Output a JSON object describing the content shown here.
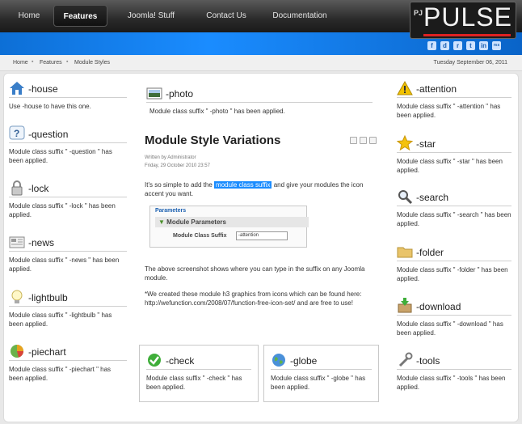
{
  "nav": {
    "items": [
      {
        "label": "Home"
      },
      {
        "label": "Features"
      },
      {
        "label": "Joomla! Stuff"
      },
      {
        "label": "Contact Us"
      },
      {
        "label": "Documentation"
      }
    ]
  },
  "logo": {
    "prefix": "PJ",
    "name": "PULSE"
  },
  "social": [
    "f",
    "d",
    "r",
    "t",
    "in",
    "rss"
  ],
  "breadcrumb": {
    "items": [
      "Home",
      "Features",
      "Module Styles"
    ],
    "date": "Tuesday September 06, 2011"
  },
  "left_modules": [
    {
      "title": "-house",
      "text": "Use -house to have this one."
    },
    {
      "title": "-question",
      "text": "Module class suffix \" -question \" has been applied."
    },
    {
      "title": "-lock",
      "text": "Module class suffix \" -lock \" has been applied."
    },
    {
      "title": "-news",
      "text": "Module class suffix \" -news \" has been applied."
    },
    {
      "title": "-lightbulb",
      "text": "Module class suffix \" -lightbulb \" has been applied."
    },
    {
      "title": "-piechart",
      "text": "Module class suffix \" -piechart \" has been applied."
    }
  ],
  "right_modules": [
    {
      "title": "-attention",
      "text": "Module class suffix \" -attention \" has been applied."
    },
    {
      "title": "-star",
      "text": "Module class suffix \" -star \" has been applied."
    },
    {
      "title": "-search",
      "text": "Module class suffix \" -search \" has been applied."
    },
    {
      "title": "-folder",
      "text": "Module class suffix \" -folder \" has been applied."
    },
    {
      "title": "-download",
      "text": "Module class suffix \" -download \" has been applied."
    },
    {
      "title": "-tools",
      "text": "Module class suffix \" -tools \" has been applied."
    }
  ],
  "center_top": {
    "title": "-photo",
    "text": "Module class suffix \" -photo \" has been applied."
  },
  "article": {
    "title": "Module Style Variations",
    "author": "Written by Administrator",
    "date": "Friday, 29 October 2010 23:57",
    "intro_before": "It's so simple to add the",
    "intro_highlight": "module class suffix",
    "intro_after": "and give your modules the icon accent you want.",
    "para2": "The above screenshot shows where you can type in the suffix on any Joomla module.",
    "para3": "*We created these module h3 graphics from icons which can be found here: http://wefunction.com/2008/07/function-free-icon-set/ and are free to use!"
  },
  "params": {
    "legend": "Parameters",
    "heading": "Module Parameters",
    "label": "Module Class Suffix",
    "value": "-attention"
  },
  "bottom_modules": [
    {
      "title": "-check",
      "text": "Module class suffix \" -check \" has been applied."
    },
    {
      "title": "-globe",
      "text": "Module class suffix \" -globe \" has been applied."
    }
  ]
}
